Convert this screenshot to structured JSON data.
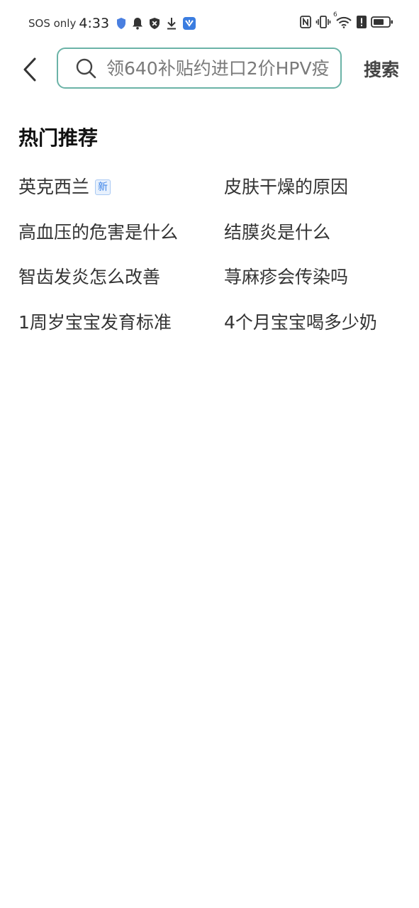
{
  "status_bar": {
    "carrier": "SOS only",
    "time": "4:33",
    "network_label": "6"
  },
  "search": {
    "placeholder": "领640补贴约进口2价HPV疫",
    "button_label": "搜索"
  },
  "hot_section": {
    "title": "热门推荐",
    "items": [
      {
        "label": "英克西兰",
        "badge": "新"
      },
      {
        "label": "皮肤干燥的原因"
      },
      {
        "label": "高血压的危害是什么"
      },
      {
        "label": "结膜炎是什么"
      },
      {
        "label": "智齿发炎怎么改善"
      },
      {
        "label": "荨麻疹会传染吗"
      },
      {
        "label": "1周岁宝宝发育标准"
      },
      {
        "label": "4个月宝宝喝多少奶"
      }
    ]
  },
  "colors": {
    "search_border": "#6bb3a7",
    "badge_text": "#3d84e8",
    "badge_bg": "#e8f1fd"
  }
}
